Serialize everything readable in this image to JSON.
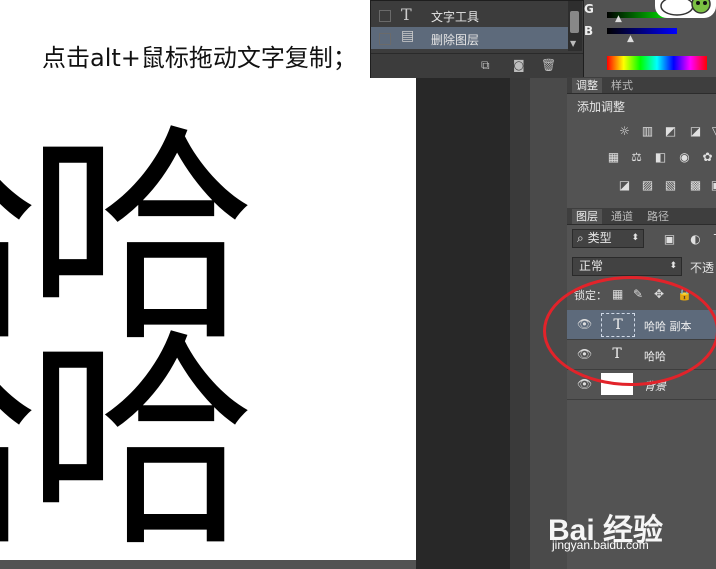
{
  "canvas": {
    "instruction": "点击alt+鼠标拖动文字复制；",
    "characters": [
      "哈",
      "哈"
    ]
  },
  "history_panel": {
    "items": [
      {
        "icon": "type-tool-icon",
        "label": "文字工具"
      },
      {
        "icon": "document-icon",
        "label": "删除图层"
      }
    ]
  },
  "color_panel": {
    "channel_b": "B",
    "channel_top": "G"
  },
  "adjustments_panel": {
    "tabs": [
      "调整",
      "样式"
    ],
    "title": "添加调整"
  },
  "layers_panel": {
    "tabs": [
      "图层",
      "通道",
      "路径"
    ],
    "filter_type": "类型",
    "blend_mode": "正常",
    "opacity_label": "不透",
    "lock_label": "锁定：",
    "layers": [
      {
        "name": "哈哈 副本",
        "kind": "text",
        "thumb": "T",
        "selected": true
      },
      {
        "name": "哈哈",
        "kind": "text",
        "thumb": "T",
        "selected": false
      },
      {
        "name": "背景",
        "kind": "image",
        "thumb": "",
        "selected": false
      }
    ]
  },
  "watermark": {
    "brand": "Bai 经验",
    "url": "jingyan.baidu.com"
  },
  "colors": {
    "highlight_circle": "#e2232a",
    "selected_layer": "#5d6a7b"
  }
}
